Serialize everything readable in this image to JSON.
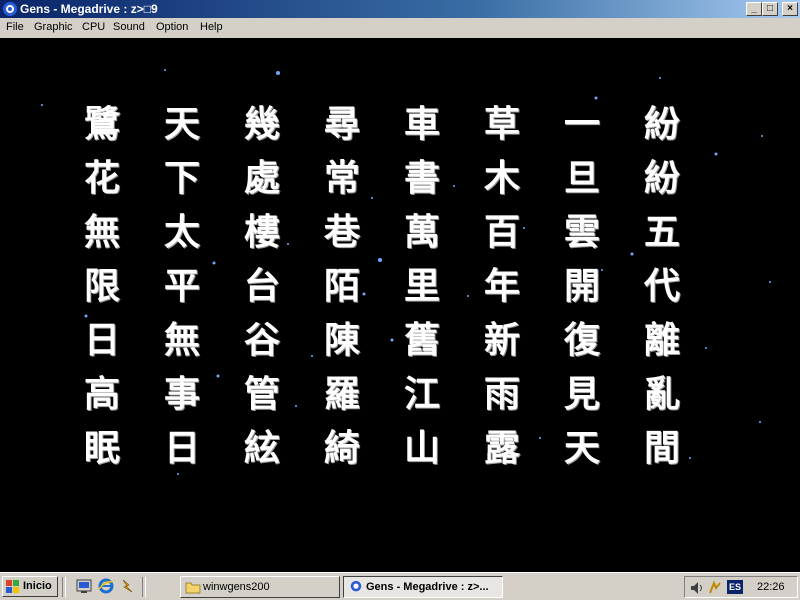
{
  "window": {
    "title": "Gens - Megadrive : z>□9",
    "app_icon": "gens-icon",
    "controls": {
      "minimize": "_",
      "maximize": "□",
      "close": "×"
    }
  },
  "menu": {
    "items": [
      "File",
      "Graphic",
      "CPU",
      "Sound",
      "Option",
      "Help"
    ]
  },
  "game": {
    "background_color": "#000000",
    "columns": [
      [
        "鷺",
        "花",
        "無",
        "限",
        "日",
        "高",
        "眠"
      ],
      [
        "天",
        "下",
        "太",
        "平",
        "無",
        "事",
        "日"
      ],
      [
        "幾",
        "處",
        "樓",
        "台",
        "谷",
        "管",
        "絃"
      ],
      [
        "尋",
        "常",
        "巷",
        "陌",
        "陳",
        "羅",
        "綺"
      ],
      [
        "車",
        "書",
        "萬",
        "里",
        "舊",
        "江",
        "山"
      ],
      [
        "草",
        "木",
        "百",
        "年",
        "新",
        "雨",
        "露"
      ],
      [
        "一",
        "旦",
        "雲",
        "開",
        "復",
        "見",
        "天"
      ],
      [
        "紛",
        "紛",
        "五",
        "代",
        "離",
        "亂",
        "間"
      ]
    ]
  },
  "taskbar": {
    "start_label": "Inicio",
    "quick_launch": [
      "show-desktop-icon",
      "internet-explorer-icon",
      "winamp-icon"
    ],
    "tasks": [
      {
        "label": "winwgens200",
        "icon": "folder-icon",
        "active": false
      },
      {
        "label": "Gens - Megadrive : z>...",
        "icon": "gens-icon",
        "active": true
      }
    ],
    "tray": {
      "icons": [
        "volume-icon",
        "network-icon"
      ],
      "language": "ES",
      "clock": "22:26"
    }
  },
  "colors": {
    "titlebar_start": "#0a246a",
    "titlebar_end": "#a6caf0",
    "chrome": "#d4d0c8",
    "text_on_game": "#ffffff"
  }
}
